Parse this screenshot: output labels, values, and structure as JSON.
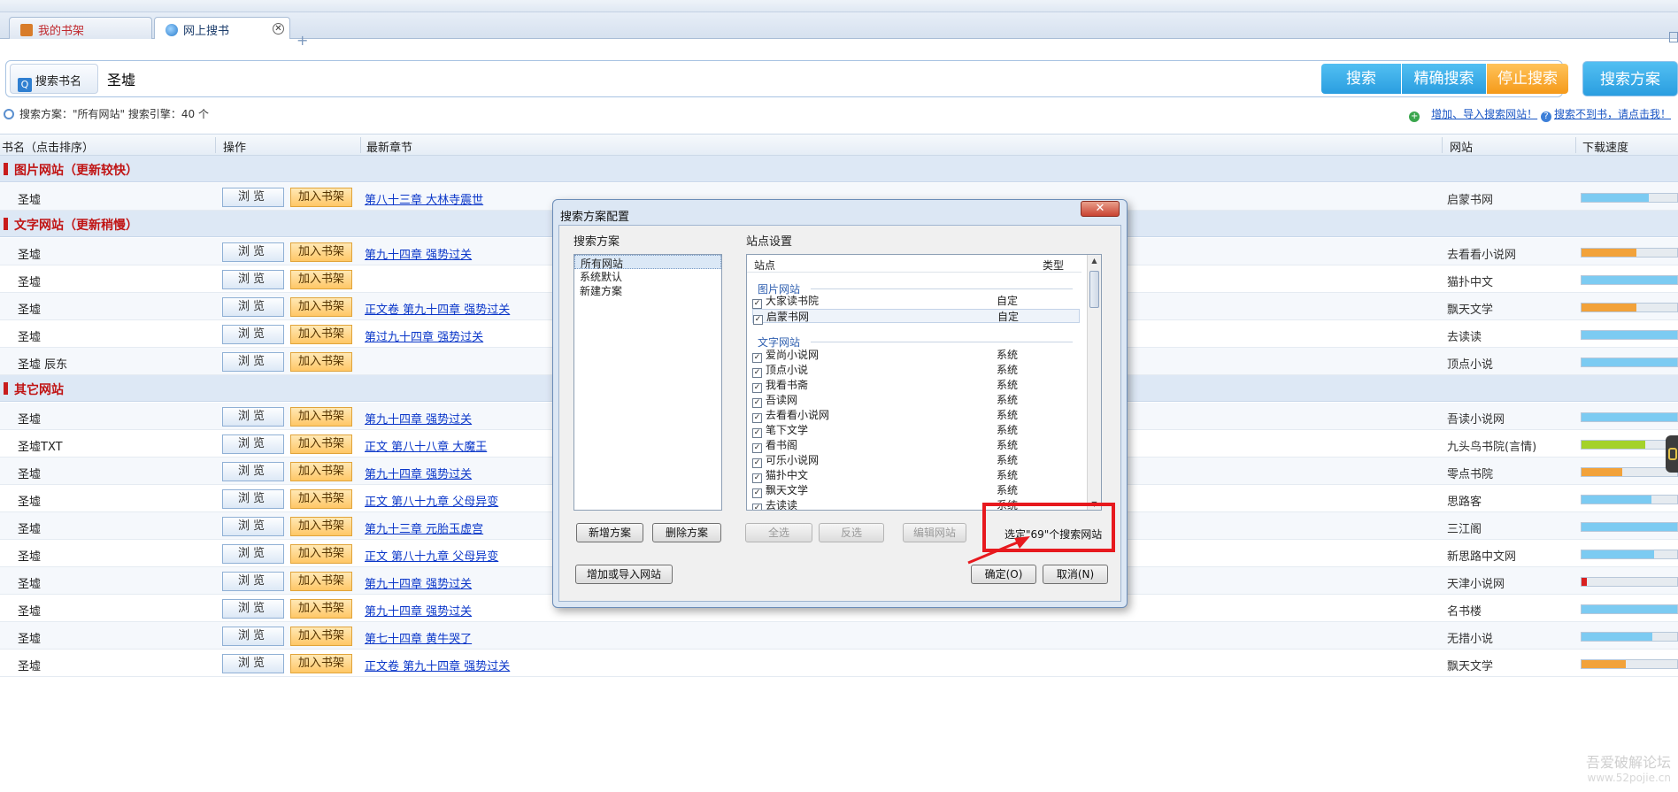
{
  "tabs": {
    "bookshelf": "我的书架",
    "search": "网上搜书",
    "close_glyph": "✕",
    "add_glyph": "+"
  },
  "search": {
    "label": "搜索书名",
    "value": "圣墟",
    "btn_search": "搜索",
    "btn_exact": "精确搜索",
    "btn_stop": "停止搜索",
    "btn_plan": "搜索方案"
  },
  "info": {
    "status": "搜索方案：\"所有网站\"   搜索引擎：40 个",
    "link_add": "增加、导入搜索网站！",
    "link_help": "搜索不到书，请点击我！"
  },
  "columns": {
    "name": "书名（点击排序）",
    "action": "操作",
    "chapter": "最新章节",
    "site": "网站",
    "speed": "下载速度"
  },
  "actions": {
    "browse": "浏览",
    "add": "加入书架"
  },
  "groups": {
    "image": "图片网站（更新较快）",
    "text": "文字网站（更新稍慢）",
    "other": "其它网站"
  },
  "colors": {
    "blue_bar": "#7ccbf2",
    "orange_bar": "#f2a23a",
    "green_bar": "#a4d22a",
    "red_bar": "#d92020"
  },
  "rows_image": [
    {
      "name": "圣墟",
      "chapter": "第八十三章 大林寺震世",
      "site": "启蒙书网",
      "speed": 0.7,
      "color": "blue"
    }
  ],
  "rows_text": [
    {
      "name": "圣墟",
      "chapter": "第九十四章 强势过关",
      "site": "去看看小说网",
      "speed": 0.57,
      "color": "orange"
    },
    {
      "name": "圣墟",
      "chapter": "",
      "site": "猫扑中文",
      "speed": 1.0,
      "color": "blue"
    },
    {
      "name": "圣墟",
      "chapter": "正文卷 第九十四章 强势过关",
      "site": "飘天文学",
      "speed": 0.57,
      "color": "orange"
    },
    {
      "name": "圣墟",
      "chapter": "第过九十四章 强势过关",
      "site": "去读读",
      "speed": 1.0,
      "color": "blue"
    },
    {
      "name": "圣墟 辰东",
      "chapter": "",
      "site": "顶点小说",
      "speed": 1.0,
      "color": "blue"
    }
  ],
  "rows_other": [
    {
      "name": "圣墟",
      "chapter": "第九十四章 强势过关",
      "site": "吾读小说网",
      "speed": 1.0,
      "color": "blue"
    },
    {
      "name": "圣墟TXT",
      "chapter": "正文 第八十八章 大魔王",
      "site": "九头鸟书院(言情)",
      "speed": 0.67,
      "color": "green"
    },
    {
      "name": "圣墟",
      "chapter": "第九十四章 强势过关",
      "site": "零点书院",
      "speed": 0.43,
      "color": "orange"
    },
    {
      "name": "圣墟",
      "chapter": "正文 第八十九章 父母异变",
      "site": "思路客",
      "speed": 0.73,
      "color": "blue"
    },
    {
      "name": "圣墟",
      "chapter": "第九十三章 元胎玉虚宫",
      "site": "三江阁",
      "speed": 1.0,
      "color": "blue"
    },
    {
      "name": "圣墟",
      "chapter": "正文 第八十九章 父母异变",
      "site": "新思路中文网",
      "speed": 0.76,
      "color": "blue"
    },
    {
      "name": "圣墟",
      "chapter": "第九十四章 强势过关",
      "site": "天津小说网",
      "speed": 0.06,
      "color": "red"
    },
    {
      "name": "圣墟",
      "chapter": "第九十四章 强势过关",
      "site": "名书楼",
      "speed": 1.0,
      "color": "blue"
    },
    {
      "name": "圣墟",
      "chapter": "第七十四章 黄牛哭了",
      "site": "无措小说",
      "speed": 0.74,
      "color": "blue"
    },
    {
      "name": "圣墟",
      "chapter": "正文卷 第九十四章 强势过关",
      "site": "飘天文学",
      "speed": 0.46,
      "color": "orange"
    }
  ],
  "dialog": {
    "title": "搜索方案配置",
    "close_glyph": "✕",
    "plans_label": "搜索方案",
    "sites_label": "站点设置",
    "plans": [
      "所有网站",
      "系统默认",
      "新建方案"
    ],
    "col_site": "站点",
    "col_type": "类型",
    "group_image": "图片网站",
    "group_text": "文字网站",
    "image_sites": [
      {
        "name": "大家读书院",
        "type": "自定"
      },
      {
        "name": "启蒙书网",
        "type": "自定"
      }
    ],
    "text_sites": [
      {
        "name": "爱尚小说网",
        "type": "系统"
      },
      {
        "name": "顶点小说",
        "type": "系统"
      },
      {
        "name": "我看书斋",
        "type": "系统"
      },
      {
        "name": "吾读网",
        "type": "系统"
      },
      {
        "name": "去看看小说网",
        "type": "系统"
      },
      {
        "name": "笔下文学",
        "type": "系统"
      },
      {
        "name": "看书阁",
        "type": "系统"
      },
      {
        "name": "可乐小说网",
        "type": "系统"
      },
      {
        "name": "猫扑中文",
        "type": "系统"
      },
      {
        "name": "飘天文学",
        "type": "系统"
      },
      {
        "name": "去读读",
        "type": "系统"
      }
    ],
    "btn_new": "新增方案",
    "btn_delete": "删除方案",
    "btn_select_all": "全选",
    "btn_invert": "反选",
    "btn_edit": "编辑网站",
    "selected_text": "选定\"69\"个搜索网站",
    "btn_import": "增加或导入网站",
    "btn_ok": "确定(O)",
    "btn_cancel": "取消(N)"
  },
  "watermark": {
    "line1": "吾爱破解论坛",
    "line2": "www.52pojie.cn"
  }
}
